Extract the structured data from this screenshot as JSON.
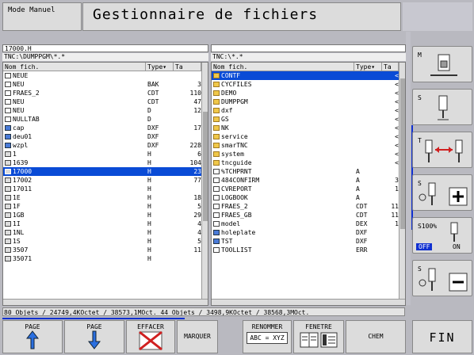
{
  "header": {
    "mode": "Mode Manuel",
    "title": "Gestionnaire de fichiers"
  },
  "left_panel": {
    "current_file": "17000.H",
    "directory": "TNC:\\DUMPPGM\\*.*",
    "columns": [
      "Nom fich.",
      "Type▾",
      "Ta"
    ],
    "rows": [
      {
        "name": "NEUE",
        "type": "",
        "size": "",
        "icon": "file"
      },
      {
        "name": "NEU",
        "type": "BAK",
        "size": "3",
        "icon": "file"
      },
      {
        "name": "FRAES_2",
        "type": "CDT",
        "size": "110",
        "icon": "file"
      },
      {
        "name": "NEU",
        "type": "CDT",
        "size": "47",
        "icon": "file"
      },
      {
        "name": "NEU",
        "type": "D",
        "size": "12",
        "icon": "file"
      },
      {
        "name": "NULLTAB",
        "type": "D",
        "size": "",
        "icon": "file"
      },
      {
        "name": "cap",
        "type": "DXF",
        "size": "17",
        "icon": "img"
      },
      {
        "name": "deu01",
        "type": "DXF",
        "size": "",
        "icon": "img"
      },
      {
        "name": "wzpl",
        "type": "DXF",
        "size": "228",
        "icon": "img"
      },
      {
        "name": "1",
        "type": "H",
        "size": "6",
        "icon": "doc"
      },
      {
        "name": "1639",
        "type": "H",
        "size": "104",
        "icon": "doc"
      },
      {
        "name": "17000",
        "type": "H",
        "size": "23",
        "icon": "doc",
        "selected": true
      },
      {
        "name": "17002",
        "type": "H",
        "size": "77",
        "icon": "doc"
      },
      {
        "name": "17011",
        "type": "H",
        "size": "",
        "icon": "doc"
      },
      {
        "name": "1E",
        "type": "H",
        "size": "18",
        "icon": "doc"
      },
      {
        "name": "1F",
        "type": "H",
        "size": "5",
        "icon": "doc"
      },
      {
        "name": "1GB",
        "type": "H",
        "size": "29",
        "icon": "doc"
      },
      {
        "name": "1I",
        "type": "H",
        "size": "4",
        "icon": "doc"
      },
      {
        "name": "1NL",
        "type": "H",
        "size": "4",
        "icon": "doc"
      },
      {
        "name": "1S",
        "type": "H",
        "size": "5",
        "icon": "doc"
      },
      {
        "name": "3507",
        "type": "H",
        "size": "11",
        "icon": "doc"
      },
      {
        "name": "35071",
        "type": "H",
        "size": "",
        "icon": "doc"
      }
    ]
  },
  "right_panel": {
    "current_file": "",
    "directory": "TNC:\\*.*",
    "columns": [
      "Nom fich.",
      "Type▾",
      "Ta"
    ],
    "rows": [
      {
        "name": "CONTF",
        "type": "",
        "size": "<",
        "icon": "folder",
        "selected": true
      },
      {
        "name": "CYCFILES",
        "type": "",
        "size": "<",
        "icon": "folder"
      },
      {
        "name": "DEMO",
        "type": "",
        "size": "<",
        "icon": "folder"
      },
      {
        "name": "DUMPPGM",
        "type": "",
        "size": "<",
        "icon": "folder"
      },
      {
        "name": "dxf",
        "type": "",
        "size": "<",
        "icon": "folder"
      },
      {
        "name": "GS",
        "type": "",
        "size": "<",
        "icon": "folder"
      },
      {
        "name": "NK",
        "type": "",
        "size": "<",
        "icon": "folder"
      },
      {
        "name": "service",
        "type": "",
        "size": "<",
        "icon": "folder"
      },
      {
        "name": "smarTNC",
        "type": "",
        "size": "<",
        "icon": "folder"
      },
      {
        "name": "system",
        "type": "",
        "size": "<",
        "icon": "folder"
      },
      {
        "name": "tncguide",
        "type": "",
        "size": "<",
        "icon": "folder"
      },
      {
        "name": "%TCHPRNT",
        "type": "A",
        "size": "",
        "icon": "file"
      },
      {
        "name": "484CONFIRM",
        "type": "A",
        "size": "3",
        "icon": "file"
      },
      {
        "name": "CVREPORT",
        "type": "A",
        "size": "1",
        "icon": "file"
      },
      {
        "name": "LOGBOOK",
        "type": "A",
        "size": "",
        "icon": "file"
      },
      {
        "name": "FRAES_2",
        "type": "CDT",
        "size": "11",
        "icon": "file"
      },
      {
        "name": "FRAES_GB",
        "type": "CDT",
        "size": "11",
        "icon": "file"
      },
      {
        "name": "model",
        "type": "DEX",
        "size": "1",
        "icon": "file"
      },
      {
        "name": "holeplate",
        "type": "DXF",
        "size": "",
        "icon": "img"
      },
      {
        "name": "TST",
        "type": "DXF",
        "size": "",
        "icon": "img"
      },
      {
        "name": "TOOLLIST",
        "type": "ERR",
        "size": "",
        "icon": "file"
      }
    ]
  },
  "status_bar": "80 Objets / 24749,4KOctet / 38573,1MOct. 44 Objets / 3498,9KOctet / 38568,3MOct.",
  "right_softkeys": [
    {
      "label": "M",
      "icon": "machine-spindle-icon"
    },
    {
      "label": "S",
      "icon": "spindle-icon"
    },
    {
      "label": "T",
      "icon": "tool-change-icon"
    },
    {
      "label": "S",
      "icon": "spindle-plus-icon"
    },
    {
      "label": "S100%",
      "label2": "OFF",
      "label3": "ON",
      "icon": "spindle-override-icon"
    },
    {
      "label": "S",
      "icon": "spindle-minus-icon"
    }
  ],
  "bottom_softkeys": [
    {
      "label": "PAGE",
      "icon": "arrow-up-icon"
    },
    {
      "label": "PAGE",
      "icon": "arrow-down-icon"
    },
    {
      "label": "EFFACER",
      "icon": "delete-x-icon"
    },
    {
      "label": "MARQUER",
      "icon": ""
    },
    {
      "label": "RENOMMER",
      "sub": "ABC = XYZ",
      "icon": "rename-icon"
    },
    {
      "label": "FENETRE",
      "icon": "window-split-icon"
    },
    {
      "label": "CHEM",
      "icon": ""
    }
  ],
  "fin_label": "FIN",
  "colors": {
    "selection": "#0a4bd6",
    "accent": "#1030d0",
    "folder": "#f0c84a"
  }
}
